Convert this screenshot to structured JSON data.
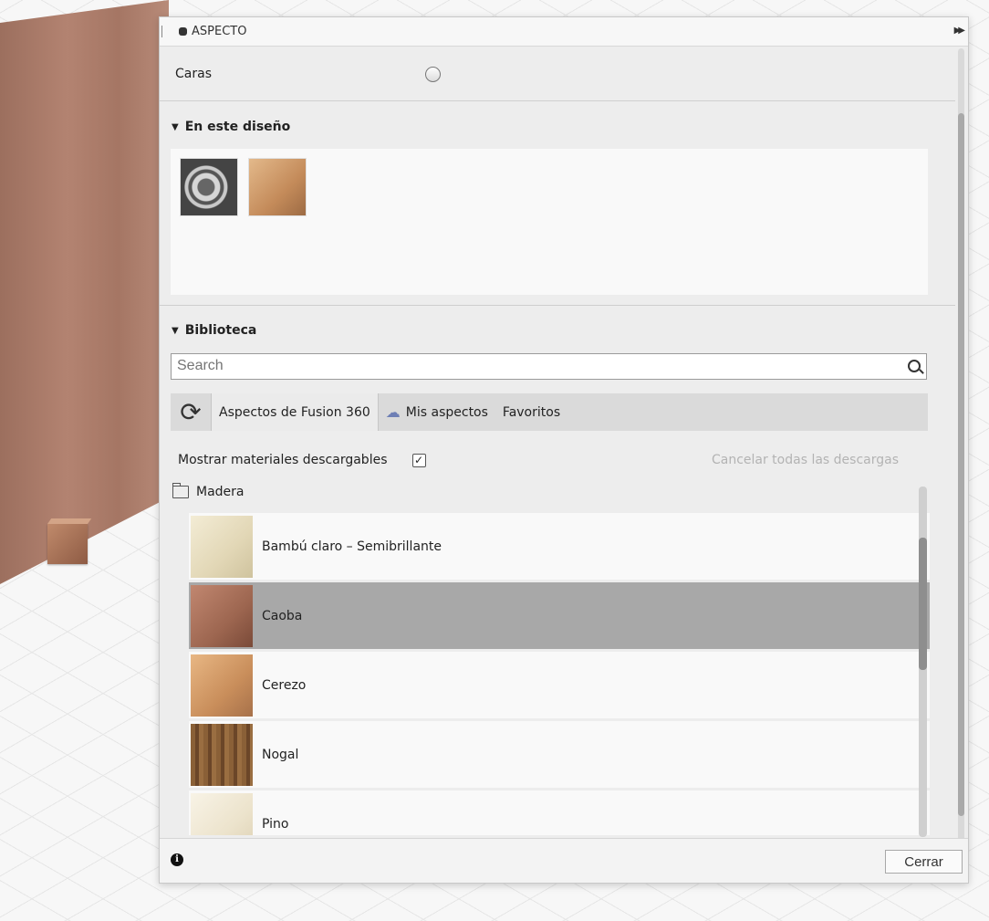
{
  "panel": {
    "title": "ASPECTO"
  },
  "caras": {
    "label": "Caras"
  },
  "design_section": {
    "title": "En este diseño"
  },
  "library_section": {
    "title": "Biblioteca"
  },
  "search": {
    "placeholder": "Search"
  },
  "tabs": [
    {
      "label": "Aspectos de Fusion 360",
      "active": true
    },
    {
      "label": "Mis aspectos",
      "icon": "cloud-icon"
    },
    {
      "label": "Favoritos"
    }
  ],
  "downloads": {
    "label": "Mostrar materiales descargables",
    "checked": true,
    "check_glyph": "✓",
    "cancel": "Cancelar todas las descargas"
  },
  "folder": {
    "name": "Madera"
  },
  "materials": [
    {
      "label": "Bambú claro – Semibrillante"
    },
    {
      "label": "Caoba",
      "selected": true
    },
    {
      "label": "Cerezo"
    },
    {
      "label": "Nogal"
    },
    {
      "label": "Pino"
    }
  ],
  "footer": {
    "info_glyph": "i",
    "close_label": "Cerrar"
  }
}
